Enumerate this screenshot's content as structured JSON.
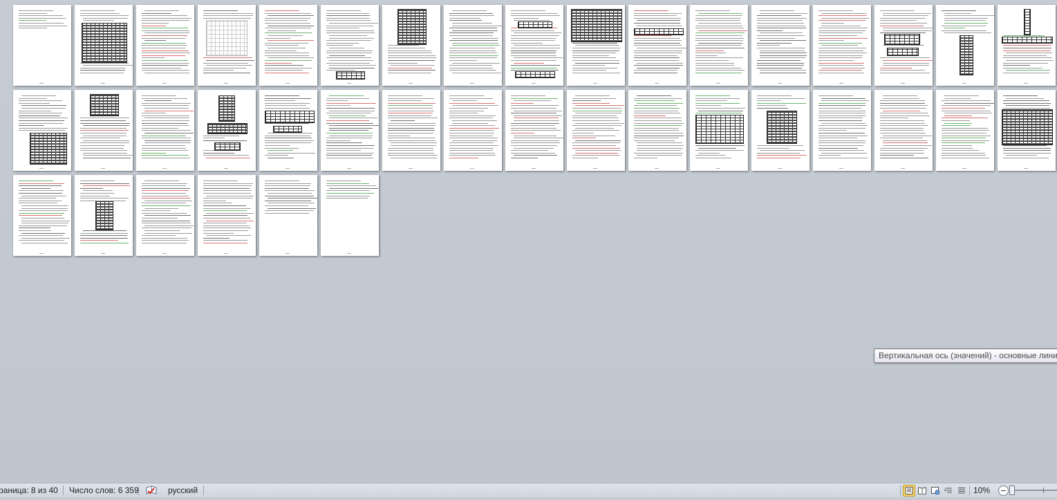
{
  "status_bar": {
    "page_label": "раница: 8 из 40",
    "words_label": "Число слов: 6 359",
    "language": "русский",
    "zoom_level": "10%",
    "proofing_icon": "spellcheck-book-icon",
    "view_icons": [
      "print-layout-icon",
      "full-screen-reading-icon",
      "web-layout-icon",
      "outline-icon",
      "draft-icon"
    ]
  },
  "tooltip": {
    "text": "Вертикальная ось (значений)  - основные лини"
  },
  "document": {
    "current_page": 8,
    "total_pages": 40,
    "visible_thumbnails": 40
  },
  "colors": {
    "workspace": "#c5cbd2",
    "statusbar": "#dfe4ea",
    "active_view": "#f7d36a",
    "spell_error": "#d87070",
    "grammar_mark": "#6bb46b"
  }
}
